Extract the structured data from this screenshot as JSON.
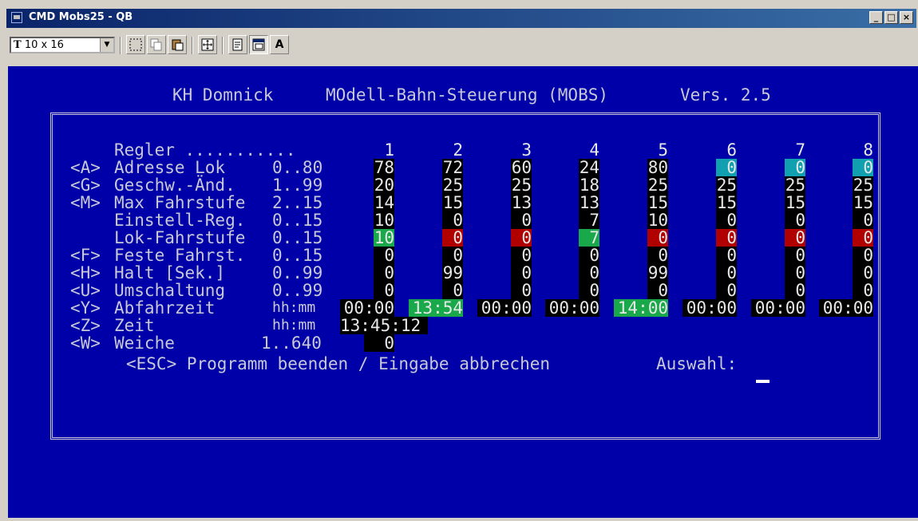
{
  "window": {
    "title": "CMD Mobs25 - QB",
    "min": "_",
    "max": "□",
    "close": "×"
  },
  "toolbar": {
    "font_size": "10 x 16",
    "font_label": "A"
  },
  "header": {
    "author": "KH Domnick",
    "title": "MOdell-Bahn-Steuerung (MOBS)",
    "version": "Vers. 2.5"
  },
  "colors": {
    "background": "#0000a8",
    "text": "#c8c8d8",
    "green": "#19a84a",
    "red": "#b00000",
    "cyan": "#10a0b0",
    "black": "#000000"
  },
  "rows": [
    {
      "key": "",
      "label": "Regler ...........",
      "range": ""
    },
    {
      "key": "<A>",
      "label": "Adresse Lok",
      "range": "0..80"
    },
    {
      "key": "<G>",
      "label": "Geschw.-Änd.",
      "range": "1..99"
    },
    {
      "key": "<M>",
      "label": "Max Fahrstufe",
      "range": "2..15"
    },
    {
      "key": "",
      "label": "Einstell-Reg.",
      "range": "0..15"
    },
    {
      "key": "",
      "label": "Lok-Fahrstufe",
      "range": "0..15"
    },
    {
      "key": "<F>",
      "label": "Feste Fahrst.",
      "range": "0..15"
    },
    {
      "key": "<H>",
      "label": "Halt [Sek.]",
      "range": "0..99"
    },
    {
      "key": "<U>",
      "label": "Umschaltung",
      "range": "0..99"
    },
    {
      "key": "<Y>",
      "label": "Abfahrzeit",
      "range": "hh:mm"
    },
    {
      "key": "<Z>",
      "label": "Zeit",
      "range": "hh:mm"
    },
    {
      "key": "<W>",
      "label": "Weiche",
      "range": "1..640"
    }
  ],
  "columns": [
    "1",
    "2",
    "3",
    "4",
    "5",
    "6",
    "7",
    "8"
  ],
  "grid": {
    "adresse": [
      "78",
      "72",
      "60",
      "24",
      "80",
      "0",
      "0",
      "0"
    ],
    "geschw": [
      "20",
      "25",
      "25",
      "18",
      "25",
      "25",
      "25",
      "25"
    ],
    "maxfahr": [
      "14",
      "15",
      "13",
      "13",
      "15",
      "15",
      "15",
      "15"
    ],
    "einstell": [
      "10",
      "0",
      "0",
      "7",
      "10",
      "0",
      "0",
      "0"
    ],
    "lokfahr": [
      "10",
      "0",
      "0",
      "7",
      "0",
      "0",
      "0",
      "0"
    ],
    "feste": [
      "0",
      "0",
      "0",
      "0",
      "0",
      "0",
      "0",
      "0"
    ],
    "halt": [
      "0",
      "99",
      "0",
      "0",
      "99",
      "0",
      "0",
      "0"
    ],
    "umschalt": [
      "0",
      "0",
      "0",
      "0",
      "0",
      "0",
      "0",
      "0"
    ],
    "abfahr": [
      "00:00",
      "13:54",
      "00:00",
      "00:00",
      "14:00",
      "00:00",
      "00:00",
      "00:00"
    ]
  },
  "zeit": "13:45:12",
  "weiche": "0",
  "footer": {
    "esc": "<ESC> Programm beenden / Eingabe abbrechen",
    "auswahl": "Auswahl:"
  }
}
